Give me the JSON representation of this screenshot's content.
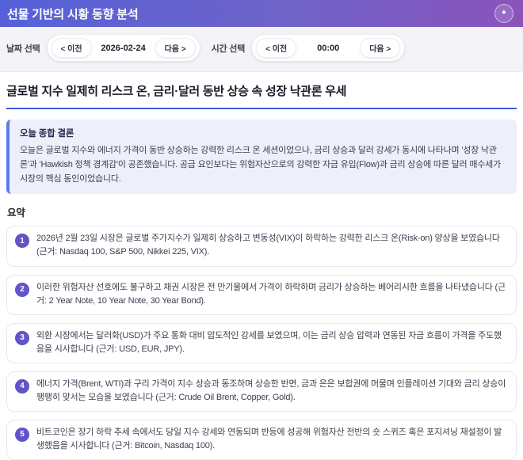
{
  "header": {
    "title": "선물 기반의 시황 동향 분석",
    "action_icon": "sparkle-icon",
    "sparkle_glyph": "✦"
  },
  "toolbar": {
    "date_label": "날짜 선택",
    "time_label": "시간 선택",
    "prev_label": "< 이전",
    "next_label": "다음 >",
    "date_value": "2026-02-24",
    "time_value": "00:00"
  },
  "main": {
    "title": "글로벌 지수 일제히 리스크 온, 금리·달러 동반 상승 속 성장 낙관론 우세",
    "conclusion": {
      "heading": "오늘 종합 결론",
      "body": "오늘은 글로벌 지수와 에너지 가격이 동반 상승하는 강력한 리스크 온 세션이었으나, 금리 상승과 달러 강세가 동시에 나타나며 '성장 낙관론'과 'Hawkish 정책 경계감'이 공존했습니다. 공급 요인보다는 위험자산으로의 강력한 자금 유입(Flow)과 금리 상승에 따른 달러 매수세가 시장의 핵심 동인이었습니다."
    },
    "summary": {
      "heading": "요약",
      "items": [
        {
          "num": "1",
          "text": "2026년 2월 23일 시장은 글로벌 주가지수가 일제히 상승하고 변동성(VIX)이 하락하는 강력한 리스크 온(Risk-on) 양상을 보였습니다 (근거: Nasdaq 100, S&P 500, Nikkei 225, VIX)."
        },
        {
          "num": "2",
          "text": "이러한 위험자산 선호에도 불구하고 채권 시장은 전 만기물에서 가격이 하락하며 금리가 상승하는 베어리시한 흐름을 나타냈습니다 (근거: 2 Year Note, 10 Year Note, 30 Year Bond)."
        },
        {
          "num": "3",
          "text": "외환 시장에서는 달러화(USD)가 주요 통화 대비 압도적인 강세를 보였으며, 이는 금리 상승 압력과 연동된 자금 흐름이 가격을 주도했음을 시사합니다 (근거: USD, EUR, JPY)."
        },
        {
          "num": "4",
          "text": "에너지 가격(Brent, WTI)과 구리 가격이 지수 상승과 동조하며 상승한 반면, 금과 은은 보합권에 머물며 인플레이션 기대와 금리 상승이 팽팽히 맞서는 모습을 보였습니다 (근거: Crude Oil Brent, Copper, Gold)."
        },
        {
          "num": "5",
          "text": "비트코인은 장기 하락 추세 속에서도 당일 지수 강세와 연동되며 반등에 성공해 위험자산 전반의 숏 스퀴즈 혹은 포지셔닝 재설정이 발생했음을 시사합니다 (근거: Bitcoin, Nasdaq 100)."
        }
      ]
    }
  },
  "colors": {
    "header_gradient_start": "#5561d8",
    "header_gradient_end": "#8a53bb",
    "title_underline_blue": "#3d5be0",
    "conclusion_bg": "#edeffb",
    "conclusion_border": "#5b7be8",
    "badge_purple": "#6153c8",
    "toolbar_bg": "#f3f3f8",
    "card_border": "#e7e8ee"
  }
}
